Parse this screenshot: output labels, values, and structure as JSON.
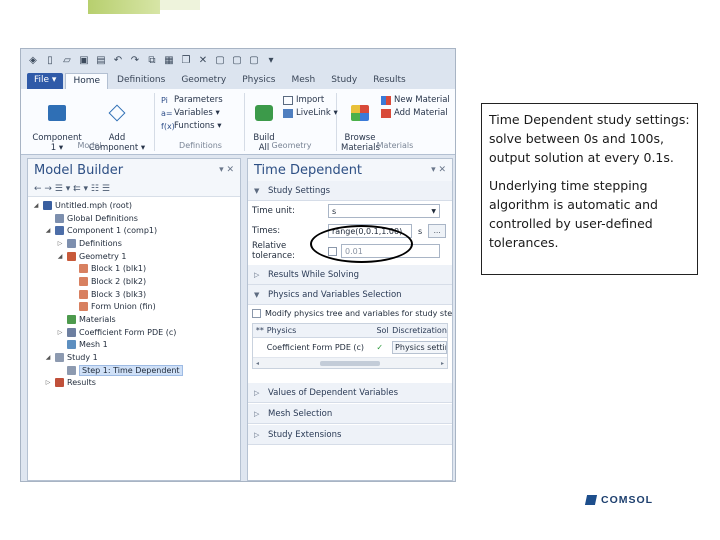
{
  "qat_icons": [
    "app-icon",
    "new-icon",
    "open-icon",
    "save-icon",
    "save-as-icon",
    "undo-icon",
    "redo-icon",
    "copy-icon",
    "paste-icon",
    "duplicate-icon",
    "delete-icon",
    "window-icon",
    "window-icon",
    "window-icon",
    "dropdown-icon"
  ],
  "tabs": [
    {
      "label": "File ▾"
    },
    {
      "label": "Home"
    },
    {
      "label": "Definitions"
    },
    {
      "label": "Geometry"
    },
    {
      "label": "Physics"
    },
    {
      "label": "Mesh"
    },
    {
      "label": "Study"
    },
    {
      "label": "Results"
    }
  ],
  "ribbon": {
    "model": {
      "component": "Component\n1 ▾",
      "add_component": "Add\nComponent ▾",
      "group": "Model"
    },
    "definitions": {
      "parameters": "Parameters",
      "variables": "Variables ▾",
      "functions": "Functions ▾",
      "group": "Definitions"
    },
    "geometry": {
      "build_all": "Build\nAll",
      "import": "Import",
      "live_link": "LiveLink ▾",
      "group": "Geometry"
    },
    "materials": {
      "browse": "Browse\nMaterials",
      "new_material": "New Material",
      "add_material": "Add Material",
      "group": "Materials"
    }
  },
  "model_builder": {
    "title": "Model Builder",
    "controls": "▾ ✕",
    "toolbar": "← → ☰ ▾ ⇇ ▾ ☷ ☰",
    "tree": [
      {
        "indent": 0,
        "twisty": "◢",
        "label": "Untitled.mph (root)",
        "icon_color": "#3a5fa0"
      },
      {
        "indent": 1,
        "twisty": "",
        "label": "Global Definitions",
        "icon_color": "#7d8fae"
      },
      {
        "indent": 1,
        "twisty": "◢",
        "label": "Component 1 (comp1)",
        "icon_color": "#4d6ea8"
      },
      {
        "indent": 2,
        "twisty": "▷",
        "label": "Definitions",
        "icon_color": "#7d8fae"
      },
      {
        "indent": 2,
        "twisty": "◢",
        "label": "Geometry 1",
        "icon_color": "#c85a3a"
      },
      {
        "indent": 3,
        "twisty": "",
        "label": "Block 1 (blk1)",
        "icon_color": "#d88060"
      },
      {
        "indent": 3,
        "twisty": "",
        "label": "Block 2 (blk2)",
        "icon_color": "#d88060"
      },
      {
        "indent": 3,
        "twisty": "",
        "label": "Block 3 (blk3)",
        "icon_color": "#d88060"
      },
      {
        "indent": 3,
        "twisty": "",
        "label": "Form Union (fin)",
        "icon_color": "#d88060"
      },
      {
        "indent": 2,
        "twisty": "",
        "label": "Materials",
        "icon_color": "#4d9a4d"
      },
      {
        "indent": 2,
        "twisty": "▷",
        "label": "Coefficient Form PDE (c)",
        "icon_color": "#6d7fa0"
      },
      {
        "indent": 2,
        "twisty": "",
        "label": "Mesh 1",
        "icon_color": "#5d8fc0"
      },
      {
        "indent": 1,
        "twisty": "◢",
        "label": "Study 1",
        "icon_color": "#8d9ab0"
      },
      {
        "indent": 2,
        "twisty": "",
        "label": "Step 1: Time Dependent",
        "icon_color": "#8d9ab0",
        "selected": true
      },
      {
        "indent": 1,
        "twisty": "▷",
        "label": "Results",
        "icon_color": "#c0503a"
      }
    ]
  },
  "settings": {
    "title": "Time Dependent",
    "controls": "▾ ✕",
    "study_settings": "Study Settings",
    "time_unit_label": "Time unit:",
    "time_unit_value": "s",
    "times_label": "Times:",
    "times_value": "range(0,0.1,1.00)",
    "times_unit": "s",
    "rel_tol_label": "Relative tolerance:",
    "rel_tol_value": "0.01",
    "results_while_solving": "Results While Solving",
    "physics_variables": "Physics and Variables Selection",
    "modify_physics": "Modify physics tree and variables for study step",
    "grid_headers": [
      "**",
      "Physics",
      "Sol",
      "Discretization"
    ],
    "grid_row": [
      "",
      "Coefficient Form PDE (c)",
      "✓",
      "Physics settings"
    ],
    "sections_bottom": [
      "Values of Dependent Variables",
      "Mesh Selection",
      "Study Extensions"
    ]
  },
  "note": {
    "p1": "Time Dependent study settings: solve between 0s and 100s, output solution at every 0.1s.",
    "p2": "Underlying time stepping algorithm is automatic and controlled by user-defined tolerances."
  },
  "logo": "COMSOL"
}
